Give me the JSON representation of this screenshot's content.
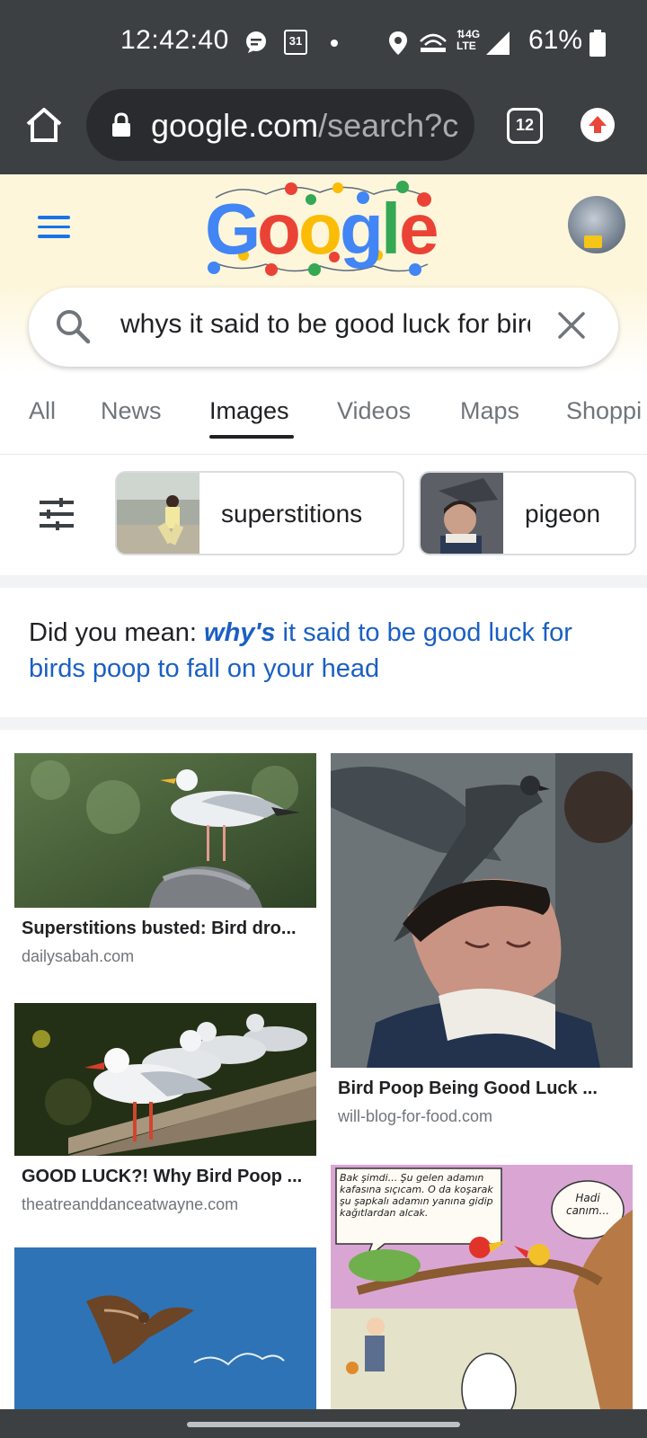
{
  "status_bar": {
    "time": "12:42:40",
    "calendar_day": "31",
    "network": "4G LTE",
    "battery": "61%"
  },
  "browser": {
    "url_host": "google.com",
    "url_path": "/search?c",
    "tab_count": "12"
  },
  "search": {
    "query": "whys it said to be good luck for birds poop to fall on your head"
  },
  "tabs": [
    {
      "label": "All"
    },
    {
      "label": "News"
    },
    {
      "label": "Images"
    },
    {
      "label": "Videos"
    },
    {
      "label": "Maps"
    },
    {
      "label": "Shoppi"
    }
  ],
  "active_tab": "Images",
  "chips": [
    {
      "label": "superstitions"
    },
    {
      "label": "pigeon"
    }
  ],
  "did_you_mean": {
    "prefix": "Did you mean: ",
    "correction": "why's",
    "rest": " it said to be good luck for birds poop to fall on your head"
  },
  "results": [
    {
      "title": "Superstitions busted: Bird dro...",
      "source": "dailysabah.com"
    },
    {
      "title": "Bird Poop Being Good Luck ...",
      "source": "will-blog-for-food.com"
    },
    {
      "title": "GOOD LUCK?! Why Bird Poop ...",
      "source": "theatreanddanceatwayne.com"
    }
  ],
  "comic": {
    "speech_left": "Bak şimdi... Şu gelen adamın kafasına sıçıcam. O da koşarak şu şapkalı adamın yanına gidip kağıtlardan alcak.",
    "speech_right": "Hadi canım..."
  },
  "colors": {
    "google_blue": "#4285f4",
    "google_red": "#ea4335",
    "google_yellow": "#fbbc05",
    "google_green": "#34a853",
    "link": "#1a5fc4",
    "system_bar": "#3c4043"
  },
  "icons": [
    "home-icon",
    "lock-icon",
    "tabs-icon",
    "update-icon",
    "menu-icon",
    "search-icon",
    "clear-icon",
    "filter-icon"
  ]
}
